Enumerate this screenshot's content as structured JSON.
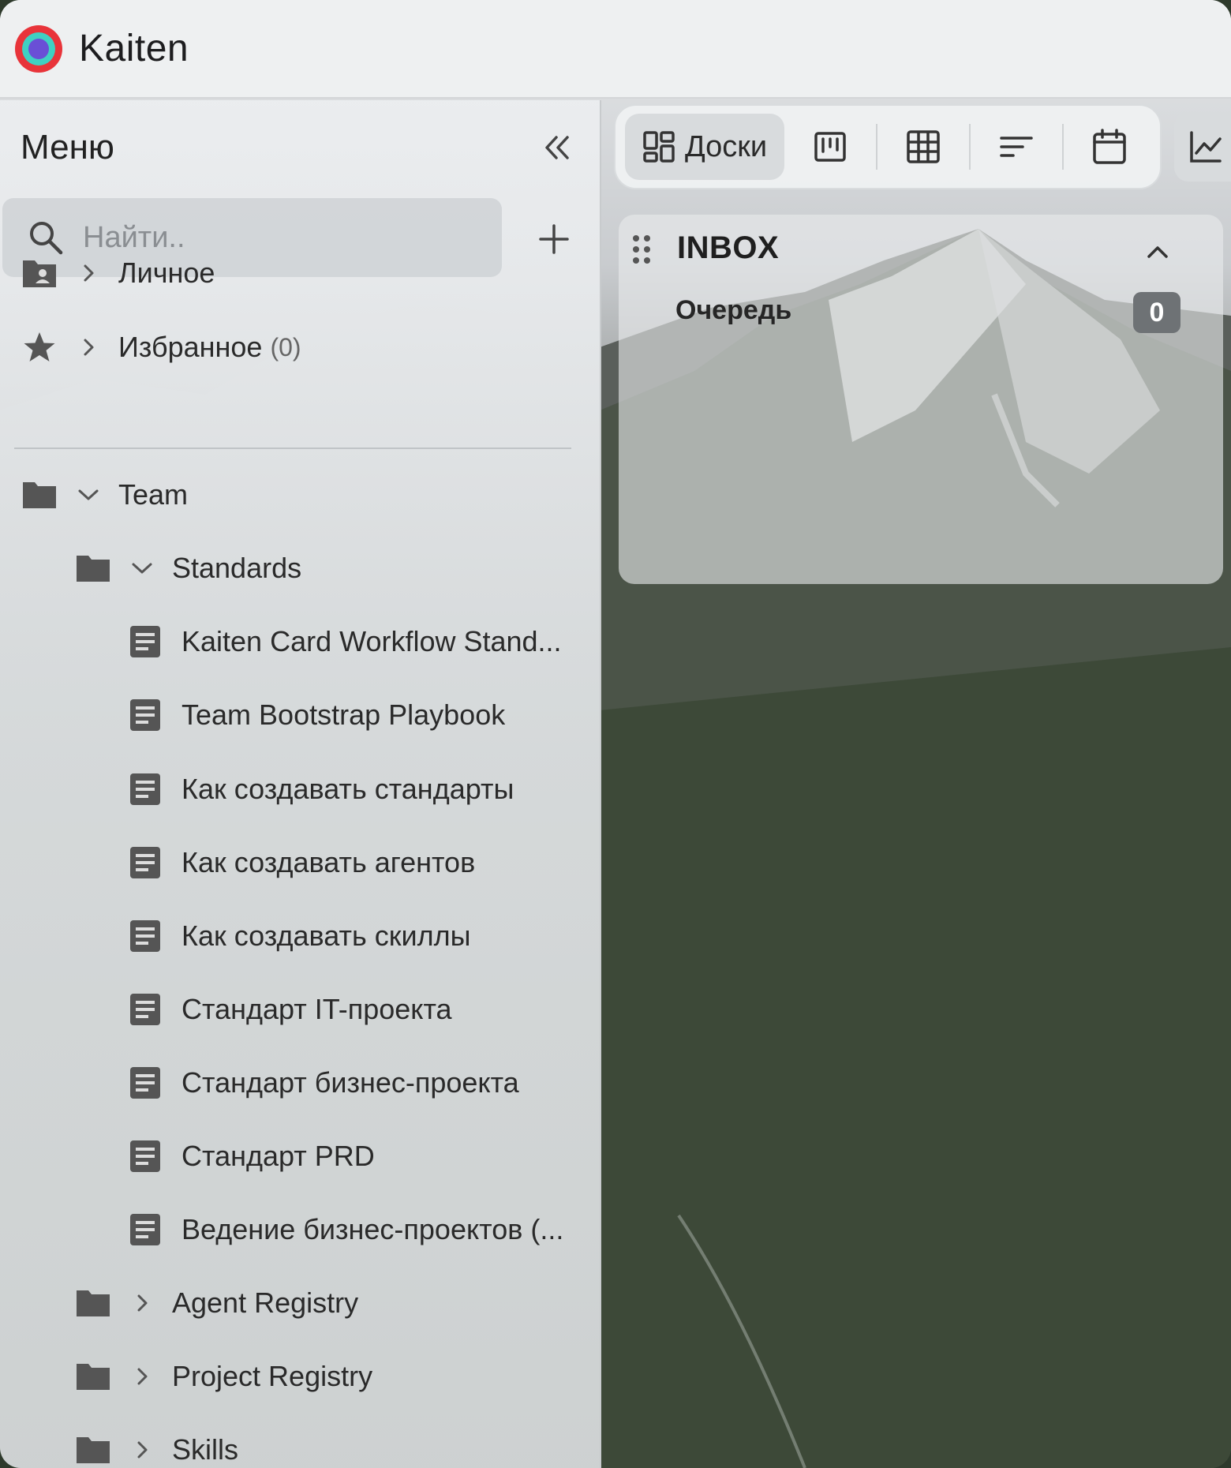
{
  "app": {
    "title": "Kaiten"
  },
  "sidebar": {
    "title": "Меню",
    "search": {
      "placeholder": "Найти..",
      "value": ""
    },
    "sections": [
      {
        "label": "Личное",
        "icon": "personal-folder-icon"
      },
      {
        "label": "Избранное",
        "count": "(0)",
        "icon": "star-icon"
      }
    ],
    "tree": {
      "team": {
        "label": "Team"
      },
      "standards": {
        "label": "Standards"
      },
      "documents": [
        {
          "label": "Kaiten Card Workflow Stand..."
        },
        {
          "label": "Team Bootstrap Playbook"
        },
        {
          "label": "Как создавать стандарты"
        },
        {
          "label": "Как создавать агентов"
        },
        {
          "label": "Как создавать скиллы"
        },
        {
          "label": "Стандарт IT-проекта"
        },
        {
          "label": "Стандарт бизнес-проекта"
        },
        {
          "label": "Стандарт PRD"
        },
        {
          "label": "Ведение бизнес-проектов (..."
        }
      ],
      "folders": [
        {
          "label": "Agent Registry"
        },
        {
          "label": "Project Registry"
        },
        {
          "label": "Skills"
        }
      ]
    }
  },
  "toolbar": {
    "boards_label": "Доски",
    "icons": [
      "board-view-icon",
      "table-view-icon",
      "list-view-icon",
      "calendar-icon",
      "chart-icon"
    ]
  },
  "inbox": {
    "title": "INBOX",
    "queue": {
      "label": "Очередь",
      "count": "0"
    }
  },
  "colors": {
    "logo_outer": "#e8343a",
    "logo_ring": "#3fd1c2",
    "logo_center": "#6a4fd6",
    "badge": "#6e7275"
  }
}
